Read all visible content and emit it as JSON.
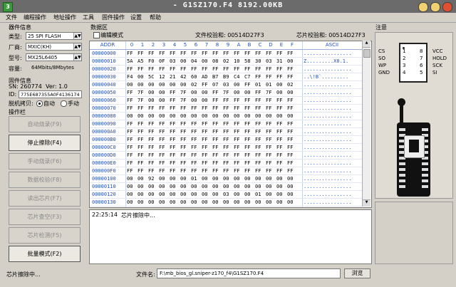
{
  "window": {
    "title": "- G1SZ170.F4   8192.00KB",
    "app_icon": "green-chip-icon"
  },
  "menu": [
    "文件",
    "编程操作",
    "地址操作",
    "工具",
    "固件操作",
    "设置",
    "帮助"
  ],
  "device": {
    "section": "器件信息",
    "type_label": "类型:",
    "type_value": "25 SPI FLASH",
    "vendor_label": "厂商:",
    "vendor_value": "MXIC(KH)",
    "model_label": "型号:",
    "model_value": "MX25L6405",
    "capacity_label": "容量:",
    "capacity_value": "64Mbits/8Mbytes"
  },
  "firmware": {
    "section": "固件信息",
    "sn": "SN: 260774",
    "ver": "Ver: 1.0",
    "id_label": "ID:",
    "id_value": "775E687355A0F4136174",
    "offline_label": "脱机拷贝:",
    "auto": "自动",
    "manual": "手动"
  },
  "ops": {
    "section": "操作栏",
    "buttons": [
      "自动烧录(F9)",
      "停止擦除(F4)",
      "手动烧录(F6)",
      "数据校验(F8)",
      "读出芯片(F7)",
      "芯片查空(F3)",
      "芯片检测(F5)",
      "批量模式(F2)"
    ]
  },
  "data_area": {
    "section": "数据区",
    "edit_mode": "编辑模式",
    "file_checksum": "文件校验和: 00514D27F3",
    "chip_checksum": "芯片校验和: 00514D27F3"
  },
  "grid": {
    "columns": [
      "ADDR",
      "0",
      "1",
      "2",
      "3",
      "4",
      "5",
      "6",
      "7",
      "8",
      "9",
      "A",
      "B",
      "C",
      "D",
      "E",
      "F",
      "ASCII"
    ],
    "rows": [
      {
        "addr": "00000000",
        "bytes": [
          "FF",
          "FF",
          "FF",
          "FF",
          "FF",
          "FF",
          "FF",
          "FF",
          "FF",
          "FF",
          "FF",
          "FF",
          "FF",
          "FF",
          "FF",
          "FF"
        ],
        "ascii": "................"
      },
      {
        "addr": "00000010",
        "bytes": [
          "5A",
          "A5",
          "F0",
          "0F",
          "03",
          "00",
          "04",
          "00",
          "08",
          "02",
          "10",
          "58",
          "30",
          "03",
          "31",
          "00"
        ],
        "ascii": "Z.........X0.1."
      },
      {
        "addr": "00000020",
        "bytes": [
          "FF",
          "FF",
          "FF",
          "FF",
          "FF",
          "FF",
          "FF",
          "FF",
          "FF",
          "FF",
          "FF",
          "FF",
          "FF",
          "FF",
          "FF",
          "FF"
        ],
        "ascii": "................"
      },
      {
        "addr": "00000030",
        "bytes": [
          "F4",
          "00",
          "5C",
          "12",
          "21",
          "42",
          "60",
          "AD",
          "B7",
          "B9",
          "C4",
          "C7",
          "FF",
          "FF",
          "FF",
          "FF"
        ],
        "ascii": "..\\!B`........."
      },
      {
        "addr": "00000040",
        "bytes": [
          "00",
          "00",
          "00",
          "00",
          "00",
          "00",
          "02",
          "FF",
          "07",
          "03",
          "00",
          "FF",
          "01",
          "01",
          "00",
          "02"
        ],
        "ascii": "................"
      },
      {
        "addr": "00000050",
        "bytes": [
          "FF",
          "7F",
          "00",
          "00",
          "FF",
          "7F",
          "00",
          "00",
          "FF",
          "7F",
          "00",
          "00",
          "FF",
          "7F",
          "00",
          "00"
        ],
        "ascii": "................"
      },
      {
        "addr": "00000060",
        "bytes": [
          "FF",
          "7F",
          "00",
          "00",
          "FF",
          "7F",
          "00",
          "00",
          "FF",
          "FF",
          "FF",
          "FF",
          "FF",
          "FF",
          "FF",
          "FF"
        ],
        "ascii": "................"
      },
      {
        "addr": "00000070",
        "bytes": [
          "FF",
          "FF",
          "FF",
          "FF",
          "FF",
          "FF",
          "FF",
          "FF",
          "FF",
          "FF",
          "FF",
          "FF",
          "FF",
          "FF",
          "FF",
          "FF"
        ],
        "ascii": "................"
      },
      {
        "addr": "00000080",
        "bytes": [
          "00",
          "00",
          "00",
          "00",
          "00",
          "00",
          "00",
          "00",
          "00",
          "00",
          "00",
          "00",
          "00",
          "00",
          "00",
          "00"
        ],
        "ascii": "................"
      },
      {
        "addr": "00000090",
        "bytes": [
          "FF",
          "FF",
          "FF",
          "FF",
          "FF",
          "FF",
          "FF",
          "FF",
          "FF",
          "FF",
          "FF",
          "FF",
          "FF",
          "FF",
          "FF",
          "FF"
        ],
        "ascii": "................"
      },
      {
        "addr": "000000A0",
        "bytes": [
          "FF",
          "FF",
          "FF",
          "FF",
          "FF",
          "FF",
          "FF",
          "FF",
          "FF",
          "FF",
          "FF",
          "FF",
          "FF",
          "FF",
          "FF",
          "FF"
        ],
        "ascii": "................"
      },
      {
        "addr": "000000B0",
        "bytes": [
          "FF",
          "FF",
          "FF",
          "FF",
          "FF",
          "FF",
          "FF",
          "FF",
          "FF",
          "FF",
          "FF",
          "FF",
          "FF",
          "FF",
          "FF",
          "FF"
        ],
        "ascii": "................"
      },
      {
        "addr": "000000C0",
        "bytes": [
          "FF",
          "FF",
          "FF",
          "FF",
          "FF",
          "FF",
          "FF",
          "FF",
          "FF",
          "FF",
          "FF",
          "FF",
          "FF",
          "FF",
          "FF",
          "FF"
        ],
        "ascii": "................"
      },
      {
        "addr": "000000D0",
        "bytes": [
          "FF",
          "FF",
          "FF",
          "FF",
          "FF",
          "FF",
          "FF",
          "FF",
          "FF",
          "FF",
          "FF",
          "FF",
          "FF",
          "FF",
          "FF",
          "FF"
        ],
        "ascii": "................"
      },
      {
        "addr": "000000E0",
        "bytes": [
          "FF",
          "FF",
          "FF",
          "FF",
          "FF",
          "FF",
          "FF",
          "FF",
          "FF",
          "FF",
          "FF",
          "FF",
          "FF",
          "FF",
          "FF",
          "FF"
        ],
        "ascii": "................"
      },
      {
        "addr": "000000F0",
        "bytes": [
          "FF",
          "FF",
          "FF",
          "FF",
          "FF",
          "FF",
          "FF",
          "FF",
          "FF",
          "FF",
          "FF",
          "FF",
          "FF",
          "FF",
          "FF",
          "FF"
        ],
        "ascii": "................"
      },
      {
        "addr": "00000100",
        "bytes": [
          "00",
          "00",
          "92",
          "00",
          "00",
          "00",
          "01",
          "00",
          "00",
          "00",
          "00",
          "00",
          "00",
          "00",
          "00",
          "00"
        ],
        "ascii": "................"
      },
      {
        "addr": "00000110",
        "bytes": [
          "00",
          "00",
          "00",
          "00",
          "00",
          "00",
          "00",
          "00",
          "00",
          "00",
          "00",
          "00",
          "00",
          "00",
          "00",
          "00"
        ],
        "ascii": "................"
      },
      {
        "addr": "00000120",
        "bytes": [
          "00",
          "00",
          "00",
          "00",
          "00",
          "00",
          "00",
          "00",
          "00",
          "03",
          "00",
          "00",
          "01",
          "00",
          "00",
          "00"
        ],
        "ascii": "................"
      },
      {
        "addr": "00000130",
        "bytes": [
          "00",
          "00",
          "00",
          "00",
          "00",
          "00",
          "00",
          "00",
          "00",
          "00",
          "00",
          "00",
          "00",
          "00",
          "00",
          "00"
        ],
        "ascii": "................"
      }
    ]
  },
  "log": {
    "time": "22:25:14",
    "message": "芯片擦除中..."
  },
  "note": {
    "section": "注意",
    "left_pins": [
      {
        "name": "CS",
        "num": "1"
      },
      {
        "name": "SO",
        "num": "2"
      },
      {
        "name": "WP",
        "num": "3"
      },
      {
        "name": "GND",
        "num": "4"
      }
    ],
    "right_pins": [
      {
        "num": "8",
        "name": "VCC"
      },
      {
        "num": "7",
        "name": "HOLD"
      },
      {
        "num": "6",
        "name": "SCK"
      },
      {
        "num": "5",
        "name": "SI"
      }
    ]
  },
  "status": {
    "text": "芯片擦除中...",
    "file_label": "文件名:",
    "file_path": "F:\\mb_bios_gl.sniper-z170_f4\\G1SZ170.F4",
    "browse": "浏览"
  },
  "colors": {
    "accent": "#2050c0",
    "titlebar": "#6b6b6b"
  }
}
